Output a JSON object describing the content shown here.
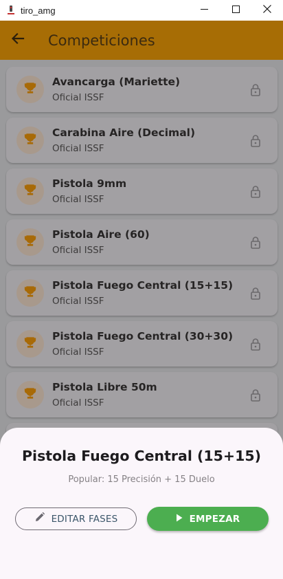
{
  "window": {
    "title": "tiro_amg",
    "controls": [
      "minimize-icon",
      "maximize-icon",
      "close-icon"
    ]
  },
  "appbar": {
    "title": "Competiciones",
    "back_icon": "arrow-left-icon",
    "color": "#a76d05"
  },
  "competitions": [
    {
      "name": "Avancarga (Mariette)",
      "subtitle": "Oficial ISSF",
      "icon": "trophy-icon",
      "locked": true
    },
    {
      "name": "Carabina Aire (Decimal)",
      "subtitle": "Oficial ISSF",
      "icon": "trophy-icon",
      "locked": true
    },
    {
      "name": "Pistola 9mm",
      "subtitle": "Oficial ISSF",
      "icon": "trophy-icon",
      "locked": true
    },
    {
      "name": "Pistola Aire (60)",
      "subtitle": "Oficial ISSF",
      "icon": "trophy-icon",
      "locked": true
    },
    {
      "name": "Pistola Fuego Central (15+15)",
      "subtitle": "Oficial ISSF",
      "icon": "trophy-icon",
      "locked": true
    },
    {
      "name": "Pistola Fuego Central (30+30)",
      "subtitle": "Oficial ISSF",
      "icon": "trophy-icon",
      "locked": true
    },
    {
      "name": "Pistola Libre 50m",
      "subtitle": "Oficial ISSF",
      "icon": "trophy-icon",
      "locked": true
    }
  ],
  "sheet": {
    "title": "Pistola Fuego Central (15+15)",
    "subtitle": "Popular: 15 Precisión + 15 Duelo",
    "edit_label": "EDITAR FASES",
    "edit_icon": "pencil-icon",
    "start_label": "EMPEZAR",
    "start_icon": "play-icon",
    "start_color": "#4cae50"
  }
}
